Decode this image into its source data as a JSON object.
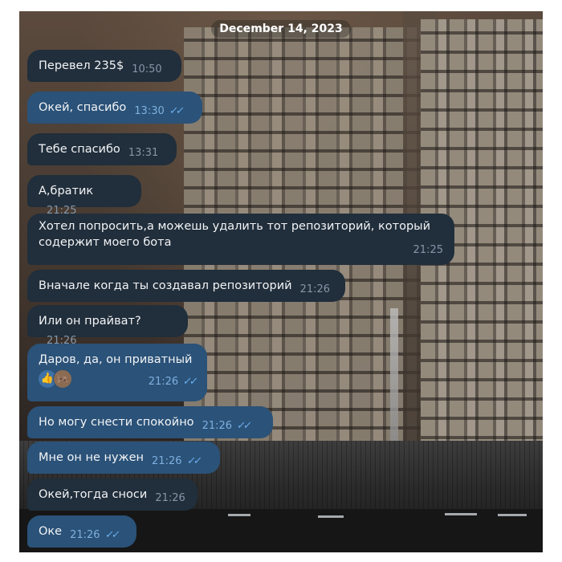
{
  "date_divider": "December 14, 2023",
  "messages": [
    {
      "text": "Перевел 235$",
      "time": "10:50",
      "dir": "in"
    },
    {
      "text": "Окей, спасибо",
      "time": "13:30",
      "dir": "out",
      "read": "✓✓"
    },
    {
      "text": "Тебе спасибо",
      "time": "13:31",
      "dir": "in"
    },
    {
      "text": "А,братик",
      "time": "21:25",
      "dir": "in"
    },
    {
      "text_line1": "Хотел попросить,а можешь удалить тот репозиторий, который",
      "text_line2": "содержит моего бота",
      "time": "21:25",
      "dir": "in"
    },
    {
      "text": "Вначале когда ты создавал репозиторий",
      "time": "21:26",
      "dir": "in"
    },
    {
      "text": "Или он прайват?",
      "time": "21:26",
      "dir": "in"
    },
    {
      "text": "Даров, да, он приватный",
      "time": "21:26",
      "dir": "out",
      "read": "✓✓",
      "reactions": [
        "👍",
        "🦗"
      ]
    },
    {
      "text": "Но могу снести спокойно",
      "time": "21:26",
      "dir": "out",
      "read": "✓✓"
    },
    {
      "text": "Мне он не нужен",
      "time": "21:26",
      "dir": "out",
      "read": "✓✓"
    },
    {
      "text": "Окей,тогда сноси",
      "time": "21:26",
      "dir": "in"
    },
    {
      "text": "Оке",
      "time": "21:26",
      "dir": "out",
      "read": "✓✓"
    }
  ],
  "colors": {
    "incoming": "#212e3b",
    "outgoing": "#2b5278",
    "check": "#6cb0f2"
  }
}
